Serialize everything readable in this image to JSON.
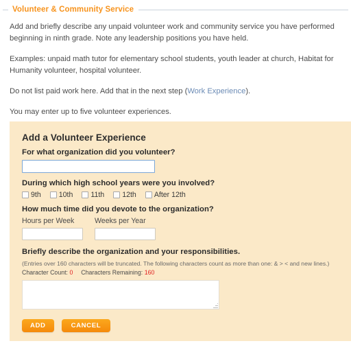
{
  "section": {
    "title": "Volunteer & Community Service"
  },
  "intro": {
    "paragraphs": [
      "Add and briefly describe any unpaid volunteer work and community service you have performed beginning in ninth grade. Note any leadership positions you have held.",
      "Examples: unpaid math tutor for elementary school students, youth leader at church, Habitat for Humanity volunteer, hospital volunteer.",
      "You may enter up to five volunteer experiences."
    ],
    "paid_work_prefix": "Do not list paid work here. Add that in the next step (",
    "paid_work_link": "Work Experience",
    "paid_work_suffix": ")."
  },
  "form": {
    "title": "Add a Volunteer Experience",
    "organization": {
      "label": "For what organization did you volunteer?",
      "value": "",
      "placeholder": ""
    },
    "years": {
      "label": "During which high school years were you involved?",
      "options": [
        {
          "label": "9th",
          "checked": false
        },
        {
          "label": "10th",
          "checked": false
        },
        {
          "label": "11th",
          "checked": false
        },
        {
          "label": "12th",
          "checked": false
        },
        {
          "label": "After 12th",
          "checked": false
        }
      ]
    },
    "time": {
      "label": "How much time did you devote to the organization?",
      "hours": {
        "caption": "Hours per Week",
        "value": "",
        "placeholder": ""
      },
      "weeks": {
        "caption": "Weeks per Year",
        "value": "",
        "placeholder": ""
      }
    },
    "description": {
      "label": "Briefly describe the organization and your responsibilities.",
      "note": "(Entries over 160 characters will be truncated. The following characters count as more than one: & > < and new lines.)",
      "count_label": "Character Count:",
      "count_value": "0",
      "remaining_label": "Characters Remaining:",
      "remaining_value": "160",
      "value": "",
      "placeholder": ""
    },
    "buttons": {
      "add": "ADD",
      "cancel": "CANCEL"
    }
  },
  "colors": {
    "accent_orange": "#f7931d",
    "panel_bg": "#fbe9c8",
    "link_blue": "#6b8bb5",
    "counter_red": "#e02020",
    "focus_border": "#7ba7d7"
  }
}
